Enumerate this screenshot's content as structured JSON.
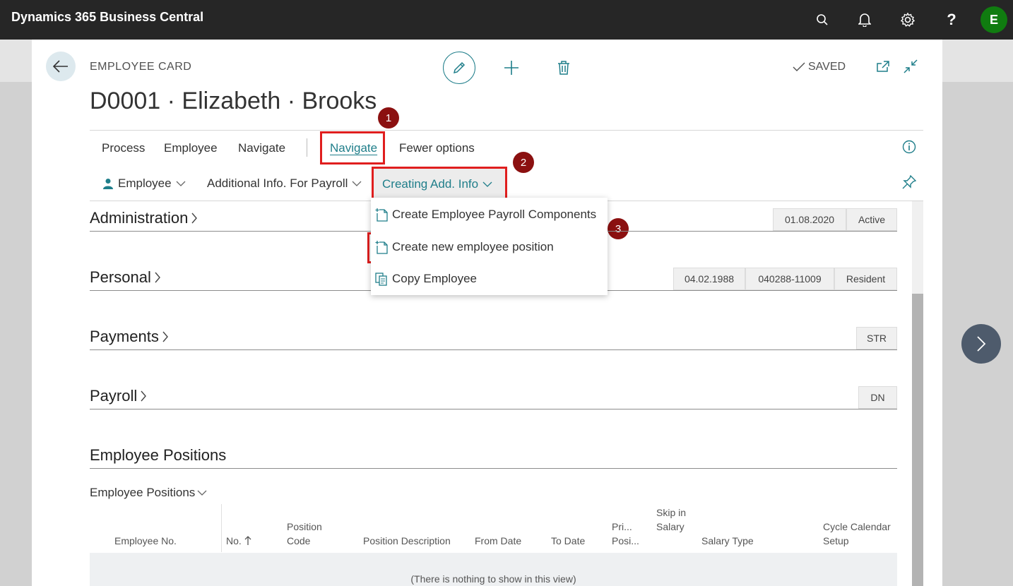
{
  "app": {
    "title": "Dynamics 365 Business Central",
    "avatar_letter": "E"
  },
  "header": {
    "caption": "EMPLOYEE CARD",
    "title": "D0001 · Elizabeth · Brooks",
    "saved_label": "SAVED"
  },
  "actions": {
    "primary": [
      "Process",
      "Employee",
      "Navigate"
    ],
    "active": "Navigate",
    "fewer": "Fewer options"
  },
  "subactions": {
    "employee": "Employee",
    "additional": "Additional Info. For Payroll",
    "creating": "Creating Add. Info"
  },
  "dropdown": {
    "items": [
      {
        "label": "Create Employee Payroll Components",
        "icon": "new-document-icon"
      },
      {
        "label": "Create new employee position",
        "icon": "new-document-icon"
      },
      {
        "label": "Copy Employee",
        "icon": "copy-icon"
      }
    ]
  },
  "badges": [
    "1",
    "2",
    "3"
  ],
  "sections": {
    "administration": {
      "title": "Administration",
      "chips": [
        "01.08.2020",
        "Active"
      ]
    },
    "personal": {
      "title": "Personal",
      "chips": [
        "04.02.1988",
        "040288-11009",
        "Resident"
      ]
    },
    "payments": {
      "title": "Payments",
      "chips": [
        "STR"
      ]
    },
    "payroll": {
      "title": "Payroll",
      "chips": [
        "DN"
      ]
    },
    "positions": {
      "title": "Employee Positions",
      "subtitle": "Employee Positions"
    }
  },
  "table": {
    "columns": [
      "Employee No.",
      "No.",
      "Position Code",
      "Position Description",
      "From Date",
      "To Date",
      "Pri... Posi...",
      "Skip in Salary",
      "Salary Type",
      "Cycle Calendar Setup"
    ],
    "empty_text": "(There is nothing to show in this view)"
  },
  "colors": {
    "accent": "#1f7e8a",
    "highlight": "#e01e1e",
    "badge": "#8b1010",
    "topbar": "#262626"
  }
}
